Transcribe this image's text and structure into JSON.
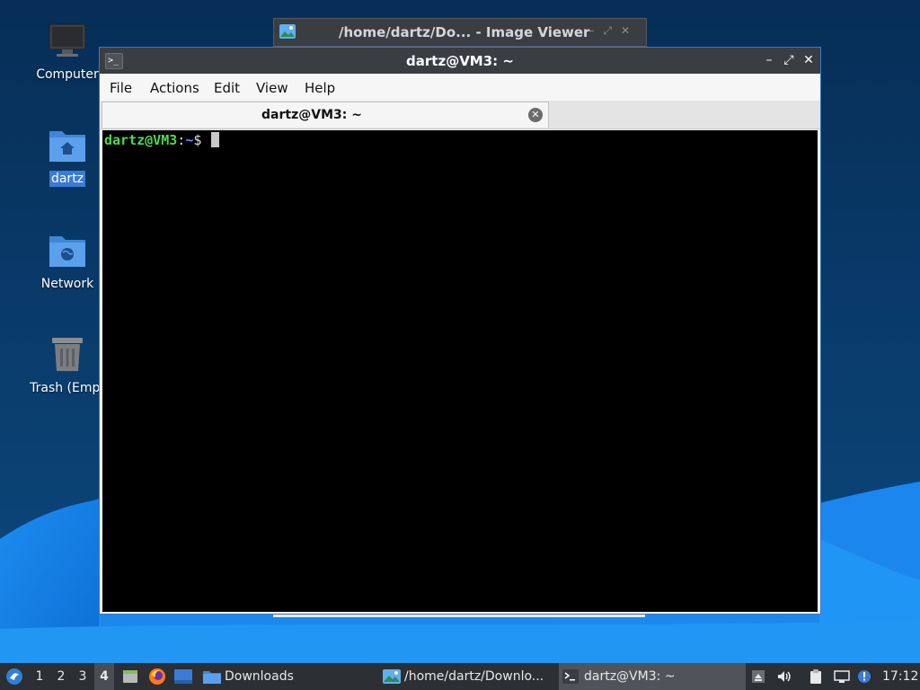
{
  "desktop": {
    "icons": [
      {
        "label": "Computer",
        "icon": "computer-icon"
      },
      {
        "label": "dartz",
        "icon": "home-folder-icon",
        "selected": true
      },
      {
        "label": "Network",
        "icon": "network-folder-icon"
      },
      {
        "label": "Trash (Empt",
        "icon": "trash-icon"
      }
    ]
  },
  "background_window": {
    "title": "/home/dartz/Do... - Image Viewer",
    "icon": "image-viewer-icon",
    "controls": [
      "–",
      "⤢",
      "✕"
    ]
  },
  "terminal": {
    "title": "dartz@VM3: ~",
    "icon": "terminal-icon",
    "controls": {
      "minimize": "–",
      "maximize": "⤢",
      "close": "✕"
    },
    "menu": [
      "File",
      "Actions",
      "Edit",
      "View",
      "Help"
    ],
    "tab_label": "dartz@VM3: ~",
    "prompt": {
      "user_host": "dartz@VM3",
      "separator": ":",
      "path": "~",
      "symbol": "$"
    }
  },
  "taskbar": {
    "start_icon": "start-menu-icon",
    "workspaces": [
      "1",
      "2",
      "3",
      "4"
    ],
    "active_workspace": "4",
    "launchers": [
      "file-manager-icon",
      "firefox-icon",
      "show-desktop-icon"
    ],
    "tasks": [
      {
        "label": "Downloads",
        "icon": "folder-icon"
      },
      {
        "label": "/home/dartz/Downlo...",
        "icon": "image-viewer-icon"
      },
      {
        "label": "dartz@VM3: ~",
        "icon": "terminal-icon",
        "active": true
      }
    ],
    "tray": [
      "eject-icon",
      "volume-icon",
      "clipboard-icon",
      "network-icon",
      "update-notifier-icon"
    ],
    "clock": "17:12"
  },
  "colors": {
    "accent": "#3b78c8",
    "prompt_user": "#4ddb4d",
    "prompt_path": "#6b8cff",
    "titlebar": "#3a3d42",
    "taskbar": "#2c2f33"
  }
}
